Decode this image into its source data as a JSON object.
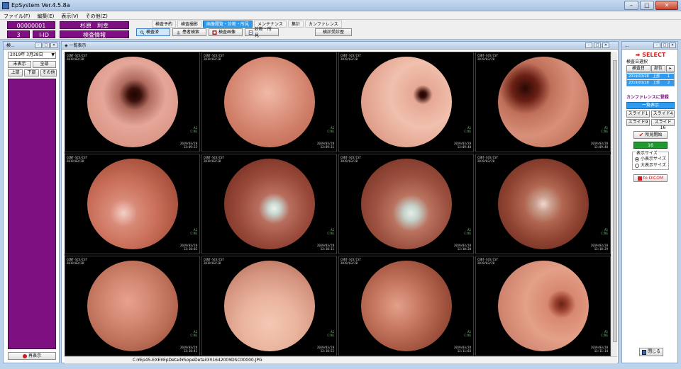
{
  "window": {
    "title": "EpSystem Ver.4.5.8a",
    "min": "–",
    "max": "□",
    "close": "✕"
  },
  "menu": [
    "ファイル(F)",
    "編集(E)",
    "表示(V)",
    "その他(Z)"
  ],
  "patient": {
    "id": "00000001",
    "name": "杉原　利幸",
    "seq": "3",
    "id_label": "I-ID",
    "exam_info": "検査情報"
  },
  "tabs": [
    {
      "label": "検査予約",
      "selected": false
    },
    {
      "label": "検査撮影",
      "selected": false
    },
    {
      "label": "画像閲覧・診断・所見",
      "selected": true
    },
    {
      "label": "メンテナンス",
      "selected": false
    },
    {
      "label": "集計",
      "selected": false
    },
    {
      "label": "カンファレンス",
      "selected": false
    }
  ],
  "toolbar": [
    {
      "label": "検査済",
      "icon": "magnifier-icon",
      "selected": true
    },
    {
      "label": "患者検索",
      "icon": "person-search-icon",
      "selected": false
    },
    {
      "label": "検査画像",
      "icon": "image-icon",
      "selected": false
    },
    {
      "label": "診断・所見",
      "icon": "document-icon",
      "selected": false
    }
  ],
  "report_button": "検診受診歴",
  "left_panel": {
    "title": "検...",
    "date": "2019年 3月28日",
    "buttons": [
      "未表示",
      "全部",
      "上部",
      "下部",
      "その他"
    ],
    "redisplay": "再表示"
  },
  "center_panel": {
    "title": "一覧表示"
  },
  "images": [
    {
      "tl": "CONT-SCV/CST\n2019/03/28",
      "br": "2019/03/28\n13:09:23",
      "mr": "A1\nC:N1"
    },
    {
      "tl": "CONT-SCV/CST\n2019/03/28",
      "br": "2019/03/28\n13:09:31",
      "mr": "A1\nC:N1"
    },
    {
      "tl": "CONT-SCV/CST\n2019/03/28",
      "br": "2019/03/28\n13:09:40",
      "mr": "A1\nC:N1"
    },
    {
      "tl": "CONT-SCV/CST\n2019/03/28",
      "br": "2019/03/28\n13:09:48",
      "mr": "A1\nC:N1"
    },
    {
      "tl": "CONT-SCV/CST\n2019/03/28",
      "br": "2019/03/28\n13:10:02",
      "mr": "A1\nC:N1"
    },
    {
      "tl": "CONT-SCV/CST\n2019/03/28",
      "br": "2019/03/28\n13:10:11",
      "mr": "A1\nC:N1"
    },
    {
      "tl": "CONT-SCV/CST\n2019/03/28",
      "br": "2019/03/28\n13:10:20",
      "mr": "A1\nC:N1"
    },
    {
      "tl": "CONT-SCV/CST\n2019/03/28",
      "br": "2019/03/28\n13:10:29",
      "mr": "A1\nC:N1"
    },
    {
      "tl": "CONT-SCV/CST\n2019/03/28",
      "br": "2019/03/28\n13:10:41",
      "mr": "A1\nC:N1"
    },
    {
      "tl": "CONT-SCV/CST\n2019/03/28",
      "br": "2019/03/28\n13:10:52",
      "mr": "A1\nC:N1"
    },
    {
      "tl": "CONT-SCV/CST\n2019/03/28",
      "br": "2019/03/28\n13:11:03",
      "mr": "A1\nC:N1"
    },
    {
      "tl": "CONT-SCV/CST\n2019/03/28",
      "br": "2019/03/28\n13:11:14",
      "mr": "A1\nC:N1"
    }
  ],
  "status_path": "C:¥Ep45-EXE¥EpDetail¥SopeDetail3¥164200¥DSC00000.JPG",
  "right_panel": {
    "title": "...",
    "select": "SELECT",
    "exam_date_label": "検査日選択",
    "col_exam_date": "検査日",
    "col_site": "部位",
    "rows": [
      {
        "date": "2019/03/28",
        "site": "上部",
        "extra": "1"
      },
      {
        "date": "2019/03/28",
        "site": "上部",
        "extra": "2"
      }
    ],
    "conference_label": "カンファレンスに登録",
    "list_display": "一覧表示",
    "slide_buttons": [
      "スライド1",
      "スライド4",
      "スライド9",
      "スライド16"
    ],
    "report_start": "所見開始",
    "count": "16",
    "display_size_label": "表示サイズ",
    "size_small": "小表示サイズ",
    "size_large": "大表示サイズ",
    "dicom": "to DICOM",
    "close": "閉じる"
  },
  "colors": {
    "purple": "#7e1081",
    "blue": "#2e9bf0",
    "select_red": "#d61f1f"
  }
}
